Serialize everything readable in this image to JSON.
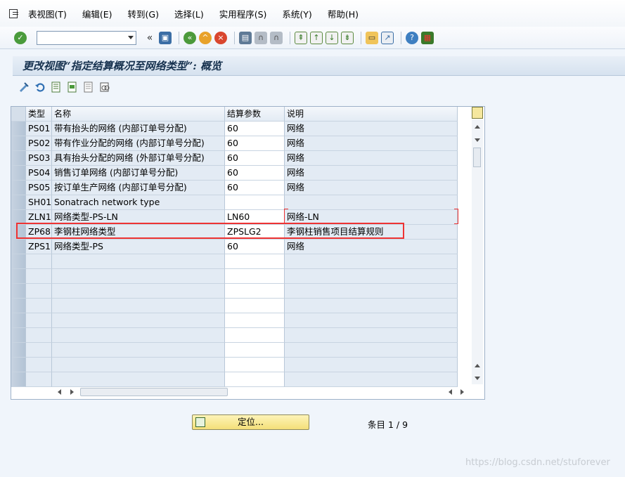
{
  "menu": [
    "表视图(T)",
    "编辑(E)",
    "转到(G)",
    "选择(L)",
    "实用程序(S)",
    "系统(Y)",
    "帮助(H)"
  ],
  "toolbar": {
    "command_value": "",
    "icons": [
      "enter-icon",
      "back-double-arrow-icon",
      "save-icon",
      "back-icon",
      "exit-icon",
      "cancel-icon",
      "print-icon",
      "find-icon",
      "find-next-icon",
      "first-page-icon",
      "previous-page-icon",
      "next-page-icon",
      "last-page-icon",
      "create-session-icon",
      "shortcut-icon",
      "help-icon",
      "customize-layout-icon"
    ]
  },
  "title": "更改视图“指定结算概况至网络类型”: 概览",
  "app_toolbar_icons": [
    "display-change-icon",
    "undo-icon",
    "select-all-icon",
    "select-block-icon",
    "deselect-all-icon",
    "print-view-icon"
  ],
  "table": {
    "headers": [
      "类型",
      "名称",
      "结算参数",
      "说明"
    ],
    "rows": [
      {
        "type": "PS01",
        "name": "带有抬头的网络 (内部订单号分配)",
        "param": "60",
        "desc": "网络"
      },
      {
        "type": "PS02",
        "name": "带有作业分配的网络 (内部订单号分配)",
        "param": "60",
        "desc": "网络"
      },
      {
        "type": "PS03",
        "name": "具有抬头分配的网络 (外部订单号分配)",
        "param": "60",
        "desc": "网络"
      },
      {
        "type": "PS04",
        "name": "销售订单网络 (内部订单号分配)",
        "param": "60",
        "desc": "网络"
      },
      {
        "type": "PS05",
        "name": "按订单生产网络 (内部订单号分配)",
        "param": "60",
        "desc": "网络"
      },
      {
        "type": "SH01",
        "name": "Sonatrach network type",
        "param": "",
        "desc": ""
      },
      {
        "type": "ZLN1",
        "name": "网络类型-PS-LN",
        "param": "LN60",
        "desc": "网络-LN"
      },
      {
        "type": "ZP68",
        "name": "李钢柱网络类型",
        "param": "ZPSLG2",
        "desc": "李钢柱销售项目结算规则"
      },
      {
        "type": "ZPS1",
        "name": "网络类型-PS",
        "param": "60",
        "desc": "网络"
      }
    ],
    "empty_rows": 9
  },
  "position_button": "定位...",
  "entries": "条目 1 / 9",
  "watermark": "https://blog.csdn.net/stuforever",
  "colors": {
    "highlight": "#e33333",
    "title_text": "#17324f",
    "button_yellow": "#f4df79"
  }
}
